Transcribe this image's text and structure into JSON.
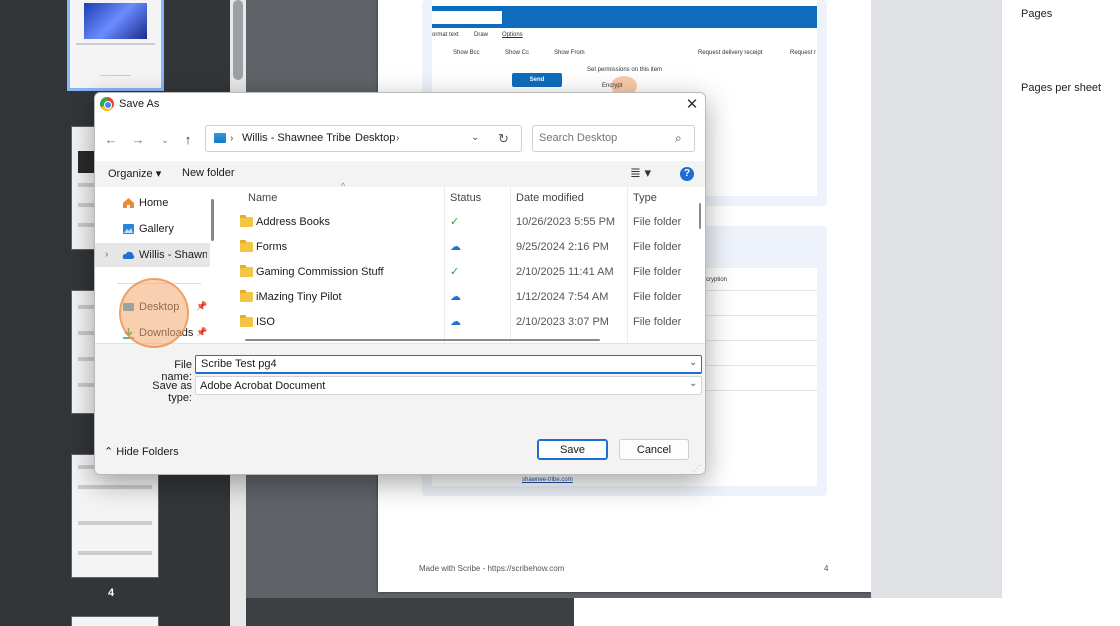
{
  "thumbnails": {
    "page_number": "4"
  },
  "preview": {
    "ribbon_tabs": [
      "ormat text",
      "Draw",
      "Options"
    ],
    "ribbon_options": [
      "Show Bcc",
      "Show Cc",
      "Show From",
      "Request delivery receipt",
      "Request r"
    ],
    "send_label": "Send",
    "permissions_label": "Set permissions on this item",
    "encrypt_label": "Encrypt",
    "encryption_label": "cryption",
    "link_label": "shawnee-tribe.com",
    "footer_text": "Made with Scribe - https://scribehow.com",
    "footer_page": "4"
  },
  "settings": {
    "pages_label": "Pages",
    "pages_per_sheet_label": "Pages per sheet"
  },
  "dialog": {
    "title": "Save As",
    "close_glyph": "✕",
    "nav": {
      "back": "←",
      "forward": "→",
      "recent": "⌄",
      "up": "↑"
    },
    "breadcrumb": [
      "Willis - Shawnee Tribe",
      "Desktop"
    ],
    "breadcrumb_sep": "›",
    "address_dropdown": "⌄",
    "refresh": "↻",
    "search": {
      "placeholder": "Search Desktop",
      "icon": "⌕"
    },
    "toolbar": {
      "organize": "Organize ▾",
      "new_folder": "New folder",
      "view": "≣ ▾",
      "help": "?"
    },
    "nav_items": [
      {
        "label": "Home",
        "icon": "home-icon"
      },
      {
        "label": "Gallery",
        "icon": "gallery-icon"
      },
      {
        "label": "Willis - Shawnee Tribe",
        "icon": "cloud-icon",
        "chevron": "›",
        "selected": true
      },
      {
        "label": "Desktop",
        "icon": "desktop-icon",
        "pin": "📌"
      },
      {
        "label": "Downloads",
        "icon": "download-icon",
        "pin": "📌"
      }
    ],
    "columns": {
      "name": "Name",
      "status": "Status",
      "date": "Date modified",
      "type": "Type",
      "sort": "^"
    },
    "files": [
      {
        "name": "Address Books",
        "status": "✓",
        "status_kind": "ok",
        "date": "10/26/2023 5:55 PM",
        "type": "File folder"
      },
      {
        "name": "Forms",
        "status": "☁",
        "status_kind": "cloud",
        "date": "9/25/2024 2:16 PM",
        "type": "File folder"
      },
      {
        "name": "Gaming Commission Stuff",
        "status": "✓",
        "status_kind": "ok",
        "date": "2/10/2025 11:41 AM",
        "type": "File folder"
      },
      {
        "name": "iMazing Tiny Pilot",
        "status": "☁",
        "status_kind": "cloud",
        "date": "1/12/2024 7:54 AM",
        "type": "File folder"
      },
      {
        "name": "ISO",
        "status": "☁",
        "status_kind": "cloud",
        "date": "2/10/2023 3:07 PM",
        "type": "File folder"
      }
    ],
    "file_name_label": "File name:",
    "file_name_value": "Scribe Test pg4",
    "save_type_label": "Save as type:",
    "save_type_value": "Adobe Acrobat Document",
    "dropdown_glyph": "⌄",
    "hide_folders": "⌃  Hide Folders",
    "save_label": "Save",
    "cancel_label": "Cancel",
    "grip": "⋰"
  },
  "colors": {
    "accent": "#1f6fd1",
    "highlight": "#f4aa6e",
    "folder": "#f4c542",
    "status_ok": "#2f9e44",
    "status_cloud": "#1f73c9"
  }
}
